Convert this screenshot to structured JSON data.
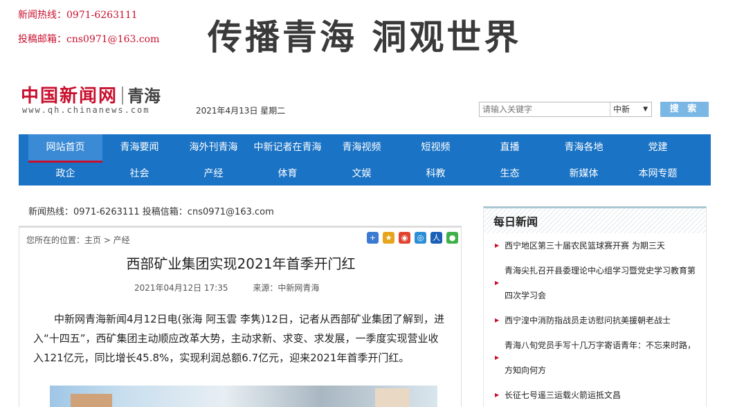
{
  "header": {
    "hotline_label": "新闻热线：0971-6263111",
    "email_label": "投稿邮箱：cns0971@163.com",
    "slogan": "传播青海 洞观世界"
  },
  "logo": {
    "brand": "中国新闻网",
    "region": "青海",
    "domain": "www.qh.chinanews.com"
  },
  "date": "2021年4月13日 星期二",
  "search": {
    "placeholder": "请输入关键字",
    "scope": "中新",
    "button": "搜 索"
  },
  "nav": {
    "row1": [
      "网站首页",
      "青海要闻",
      "海外刊青海",
      "中新记者在青海",
      "青海视频",
      "短视频",
      "直播",
      "青海各地",
      "党建"
    ],
    "row2": [
      "政企",
      "社会",
      "产经",
      "体育",
      "文娱",
      "科教",
      "生态",
      "新媒体",
      "本网专题"
    ],
    "active": "网站首页"
  },
  "info_bar": "新闻热线：0971-6263111 投稿信箱：cns0971@163.com",
  "article": {
    "breadcrumb": "您所在的位置：主页 > 产经",
    "title": "西部矿业集团实现2021年首季开门红",
    "time": "2021年04月12日 17:35",
    "source": "来源：中新网青海",
    "body": "中新网青海新闻4月12日电(张海 阿玉雲 李隽)12日，记者从西部矿业集团了解到，进入“十四五”，西矿集团主动顺应改革大势，主动求新、求变、求发展，一季度实现营业收入121亿元，同比增长45.8%，实现利润总额6.7亿元，迎来2021年首季开门红。"
  },
  "share_icons": [
    {
      "name": "plus-share-icon",
      "color": "#3b7bd1",
      "glyph": "+"
    },
    {
      "name": "qzone-share-icon",
      "color": "#e7a51d",
      "glyph": "★"
    },
    {
      "name": "weibo-share-icon",
      "color": "#e2432f",
      "glyph": "◉"
    },
    {
      "name": "tencent-weibo-share-icon",
      "color": "#2a8ed8",
      "glyph": "◎"
    },
    {
      "name": "renren-share-icon",
      "color": "#1b5fb8",
      "glyph": "人"
    },
    {
      "name": "wechat-share-icon",
      "color": "#3fb14a",
      "glyph": "●"
    }
  ],
  "daily_news": {
    "heading": "每日新闻",
    "items": [
      "西宁地区第三十届农民篮球赛开赛 为期三天",
      "青海尖扎召开县委理论中心组学习暨党史学习教育第四次学习会",
      "西宁湟中消防指战员走访慰问抗美援朝老战士",
      "青海八旬党员手写十几万字寄语青年：不忘来时路，方知向何方",
      "长征七号遥三运载火箭运抵文昌"
    ]
  }
}
